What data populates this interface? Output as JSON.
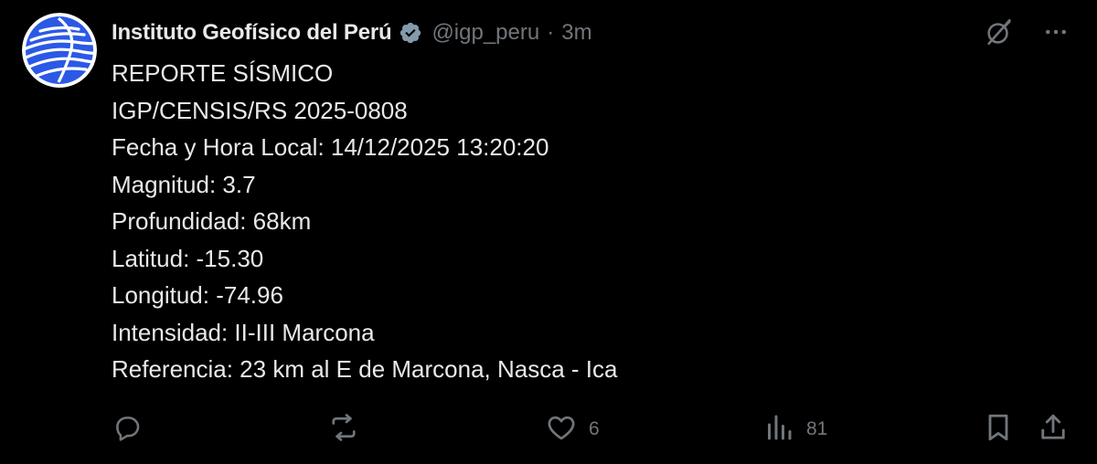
{
  "tweet": {
    "display_name": "Instituto Geofísico del Perú",
    "handle": "@igp_peru",
    "separator": "·",
    "time": "3m",
    "lines": [
      "REPORTE SÍSMICO",
      "IGP/CENSIS/RS 2025-0808",
      "Fecha y Hora Local: 14/12/2025 13:20:20",
      "Magnitud: 3.7",
      "Profundidad: 68km",
      "Latitud: -15.30",
      "Longitud: -74.96",
      "Intensidad: II-III Marcona",
      "Referencia: 23 km al E de Marcona, Nasca - Ica"
    ]
  },
  "actions": {
    "likes": "6",
    "views": "81"
  },
  "icons": {
    "verified": "verified-badge-icon",
    "grok": "grok-icon",
    "more": "more-icon",
    "reply": "reply-icon",
    "repost": "repost-icon",
    "like": "heart-icon",
    "views": "analytics-icon",
    "bookmark": "bookmark-icon",
    "share": "share-icon"
  },
  "colors": {
    "background": "#000000",
    "text_primary": "#e7e9ea",
    "text_secondary": "#71767b",
    "avatar_blue": "#2b59e6"
  }
}
